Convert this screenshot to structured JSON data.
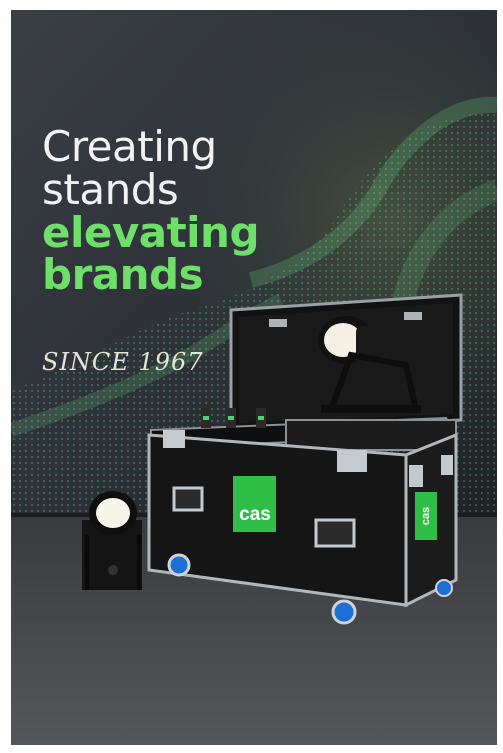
{
  "poster": {
    "headline": {
      "line1": "Creating",
      "line2": "stands",
      "line3": "elevating",
      "line4": "brands"
    },
    "tagline": "SINCE 1967",
    "case_logo": "cas",
    "side_logo": "cas"
  },
  "colors": {
    "background_wall": "#2a2d33",
    "accent_green": "#6ee06a",
    "case_black": "#151515",
    "floor": "#4a4a4e"
  }
}
